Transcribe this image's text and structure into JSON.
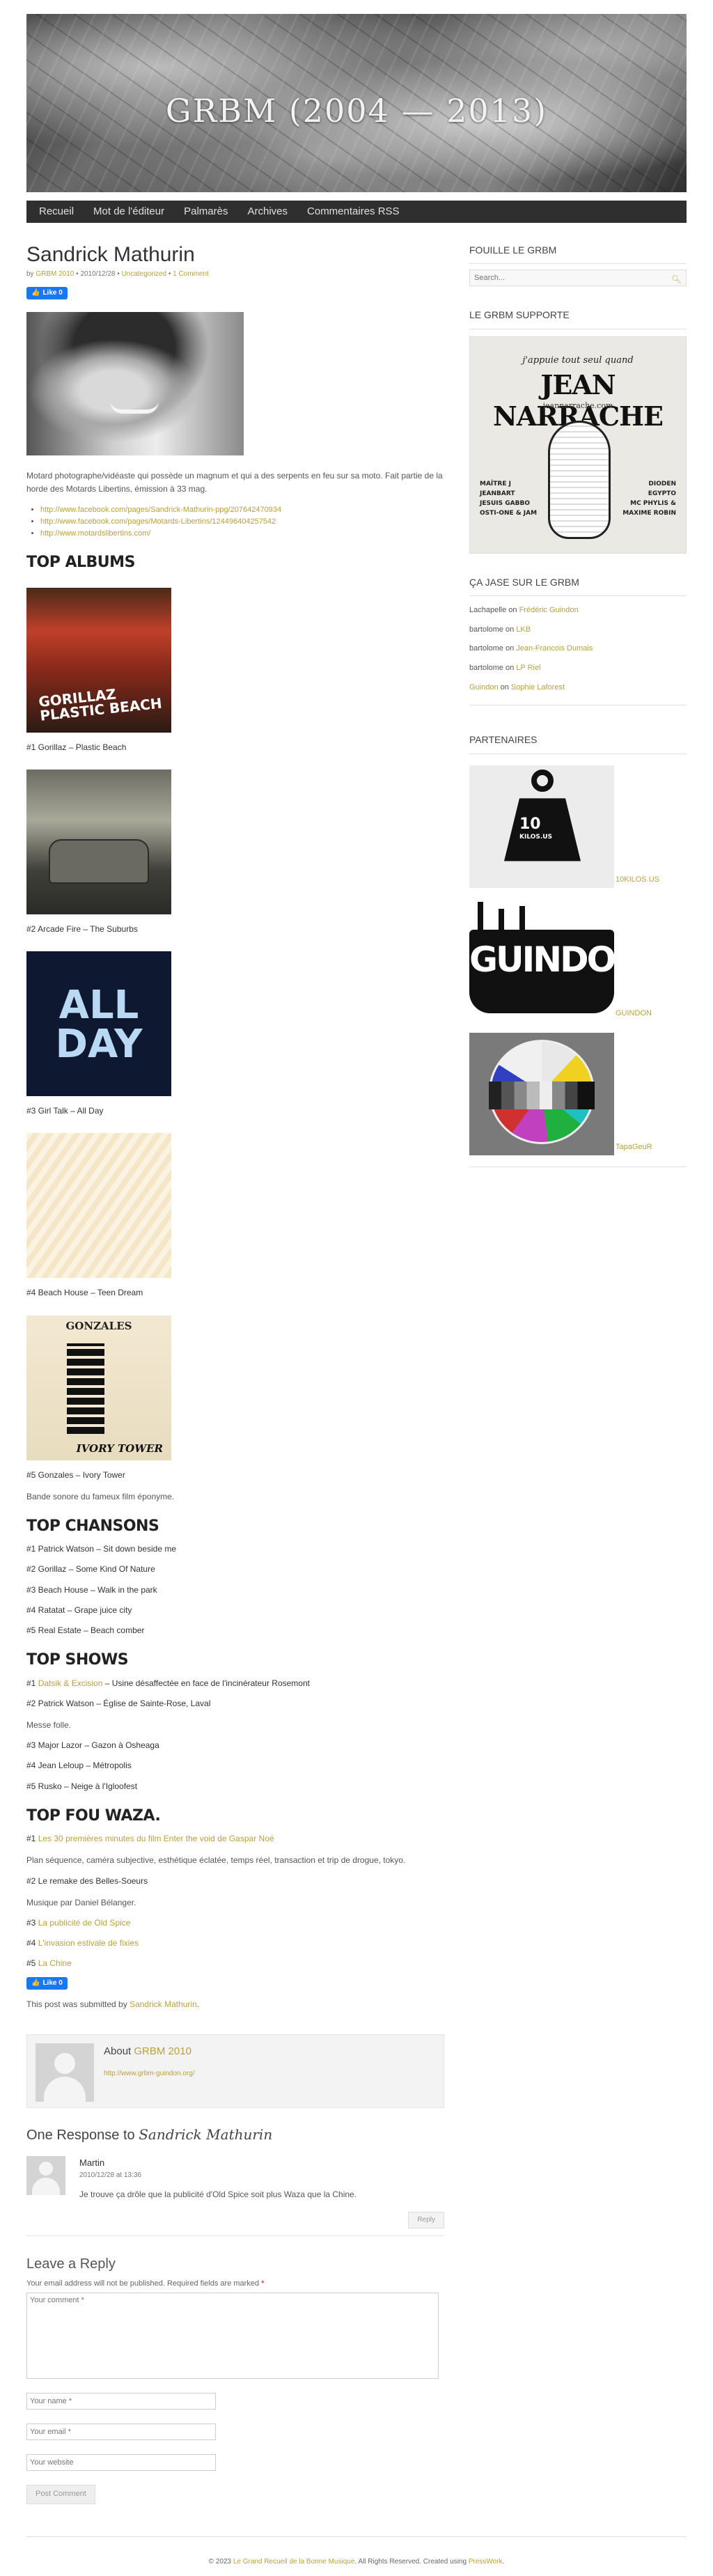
{
  "site": {
    "title": "GRBM (2004 — 2013)"
  },
  "nav": [
    "Recueil",
    "Mot de l'éditeur",
    "Palmarès",
    "Archives",
    "Commentaires RSS"
  ],
  "post": {
    "title": "Sandrick Mathurin",
    "meta_by": "by",
    "author": "GRBM 2010",
    "date": "2010/12/28",
    "category": "Uncategorized",
    "comments": "1 Comment",
    "like_label": "Like 0",
    "bio": "Motard photographe/vidéaste qui possède un magnum et qui a des serpents en feu sur sa moto. Fait partie de la horde des Motards Libertins, émission à 33 mag.",
    "links": [
      "http://www.facebook.com/pages/Sandrick-Mathurin-ppg/207642470934",
      "http://www.facebook.com/pages/Motards-Libertins/124496404257542",
      "http://www.motardslibertins.com/"
    ],
    "top_albums_title": "TOP ALBUMS",
    "albums": [
      {
        "label": "#1 Gorillaz – Plastic Beach",
        "cover_text": "GORILLAZ PLASTIC BEACH"
      },
      {
        "label": "#2 Arcade Fire – The Suburbs"
      },
      {
        "label": "#3 Girl Talk – All Day",
        "cover_text": "ALL DAY"
      },
      {
        "label": "#4 Beach House – Teen Dream"
      },
      {
        "label": "#5 Gonzales – Ivory Tower",
        "cover_top": "GONZALES",
        "cover_bottom": "IVORY TOWER"
      }
    ],
    "album5_note": "Bande sonore du fameux film éponyme.",
    "top_chansons_title": "TOP CHANSONS",
    "chansons": [
      "#1 Patrick Watson – Sit down beside me",
      "#2 Gorillaz – Some Kind Of Nature",
      "#3 Beach House – Walk in the park",
      "#4 Ratatat – Grape juice city",
      "#5 Real Estate – Beach comber"
    ],
    "top_shows_title": "TOP SHOWS",
    "shows": {
      "s1_num": "#1",
      "s1_link": "Datsik & Excision",
      "s1_rest": " – Usine désaffectée en face de l'incinérateur Rosemont",
      "s2": "#2 Patrick Watson – Église de Sainte-Rose, Laval",
      "s2_note": "Messe folle.",
      "s3": "#3 Major Lazor – Gazon à Osheaga",
      "s4": "#4 Jean Leloup – Métropolis",
      "s5": "#5 Rusko – Neige à l'Igloofest"
    },
    "top_waza_title": "TOP FOU WAZA.",
    "waza": {
      "w1_num": "#1",
      "w1_link": "Les 30 premières minutes du film Enter the void de Gaspar Noé",
      "w1_note": "Plan séquence, caméra subjective, esthétique éclatée, temps réel, transaction et trip de drogue, tokyo.",
      "w2": "#2 Le remake des Belles-Soeurs",
      "w2_note": "Musique par Daniel Bélanger.",
      "w3_num": "#3",
      "w3_link": "La publicité de Old Spice",
      "w4_num": "#4",
      "w4_link": "L'invasion estivale de fixies",
      "w5_num": "#5",
      "w5_link": "La Chine"
    },
    "submitted_prefix": "This post was submitted by ",
    "submitted_author": "Sandrick Mathurin",
    "submitted_suffix": "."
  },
  "about": {
    "prefix": "About ",
    "name": "GRBM 2010",
    "link": "http://www.grbm-guindon.org/"
  },
  "responses": {
    "title_prefix": "One Response to ",
    "title_em": "Sandrick Mathurin",
    "comment": {
      "author": "Martin",
      "date": "2010/12/28 at 13:36",
      "text": "Je trouve ça drôle que la publicité d'Old Spice soit plus Waza que la Chine.",
      "reply": "Reply"
    }
  },
  "reply_form": {
    "title": "Leave a Reply",
    "note": "Your email address will not be published. Required fields are marked ",
    "star": "*",
    "comment_placeholder": "Your comment *",
    "name_placeholder": "Your name *",
    "email_placeholder": "Your email *",
    "website_placeholder": "Your website",
    "submit": "Post Comment"
  },
  "sidebar": {
    "search_title": "FOUILLE LE GRBM",
    "search_placeholder": "Search...",
    "support_title": "LE GRBM SUPPORTE",
    "support_img": {
      "line1": "j'appuie tout seul quand",
      "line2": "JEAN NARRACHE",
      "site": "jeannarrache.com",
      "left": [
        "MAÎTRE J",
        "JEANBART",
        "JESUIS GABBO",
        "OSTI-ONE & JAM"
      ],
      "right": [
        "DIODEN",
        "EGYPTO",
        "MC PHYLIS &",
        "MAXIME ROBIN"
      ]
    },
    "recent_title": "ÇA JASE SUR LE GRBM",
    "recent": [
      {
        "who": "Lachapelle",
        "on": " on ",
        "post": "Frédéric Guindon"
      },
      {
        "who": "bartolome",
        "on": " on ",
        "post": "LKB"
      },
      {
        "who": "bartolome",
        "on": " on ",
        "post": "Jean-Francois Dumais"
      },
      {
        "who": "bartolome",
        "on": " on ",
        "post": "LP Riel"
      },
      {
        "who": "Guindon",
        "on": " on ",
        "post": "Sophie Laforest"
      }
    ],
    "partners_title": "PARTENAIRES",
    "partners": [
      {
        "label": "10KILOS.US",
        "logo_text": "10",
        "logo_sub": "KILOS.US"
      },
      {
        "label": "GUINDON",
        "logo_text": "GUINDON"
      },
      {
        "label": "TapaGeuR"
      }
    ]
  },
  "footer": {
    "prefix": "© 2023 ",
    "site": "Le Grand Recueil de la Bonne Musique",
    "middle": ". All Rights Reserved. Created using ",
    "engine": "PressWork",
    "suffix": "."
  },
  "colors": {
    "link": "#b8a040",
    "nav_bg": "#2f2f2f",
    "like": "#1877f2"
  }
}
